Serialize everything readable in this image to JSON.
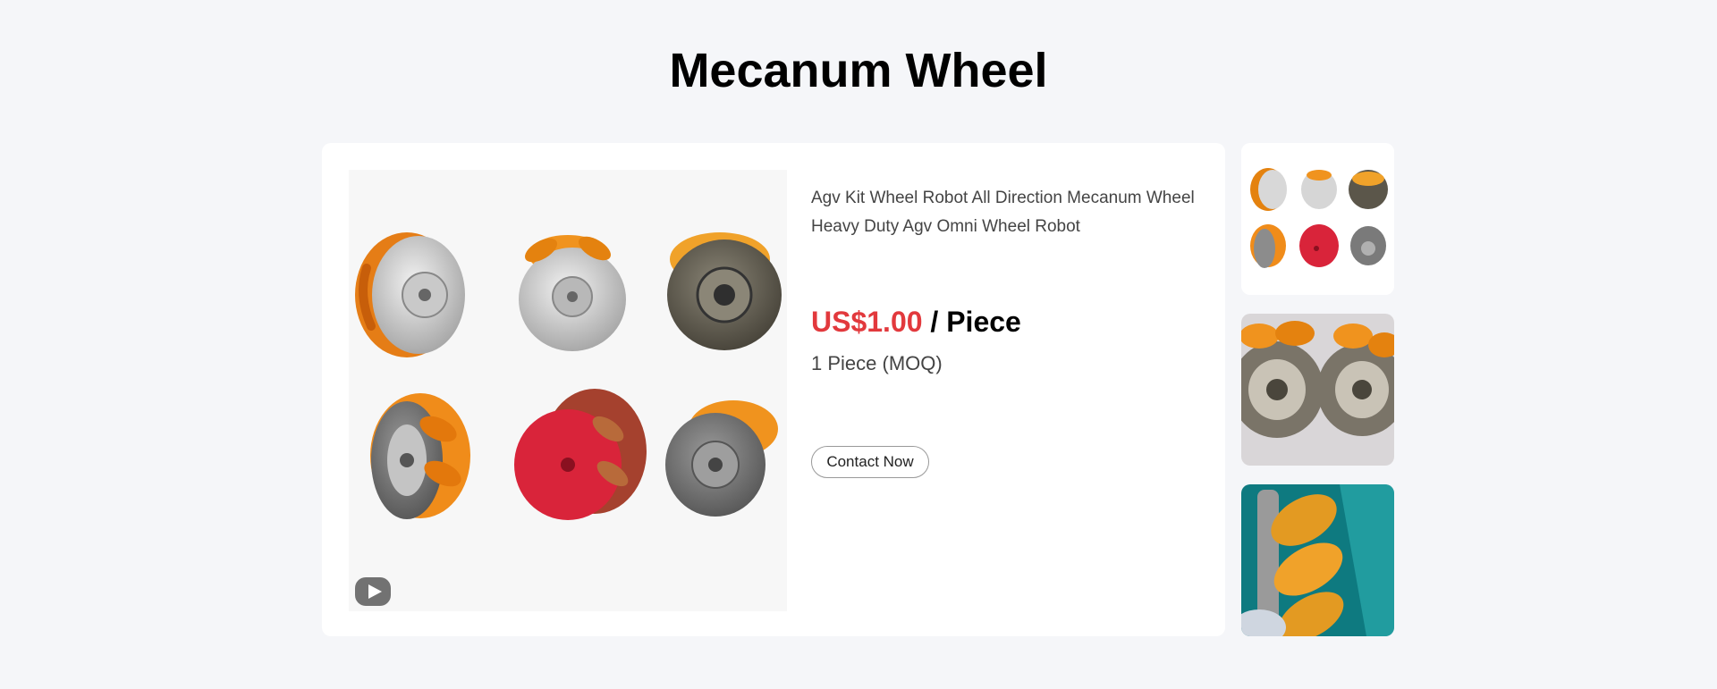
{
  "page": {
    "title": "Mecanum Wheel"
  },
  "product": {
    "name": "Agv Kit Wheel Robot All Direction Mecanum Wheel Heavy Duty Agv Omni Wheel Robot",
    "price": "US$1.00",
    "price_unit": " / Piece",
    "moq": "1 Piece (MOQ)",
    "contact_label": "Contact Now"
  },
  "colors": {
    "price": "#e2393d",
    "roller_orange": "#f0931e",
    "red_hub": "#d9243a",
    "background": "#f5f6f9"
  },
  "icons": {
    "video": "play-icon"
  },
  "thumbnails": [
    {
      "name": "thumbnail-six-wheels"
    },
    {
      "name": "thumbnail-two-wheels"
    },
    {
      "name": "thumbnail-wheel-closeup"
    }
  ]
}
